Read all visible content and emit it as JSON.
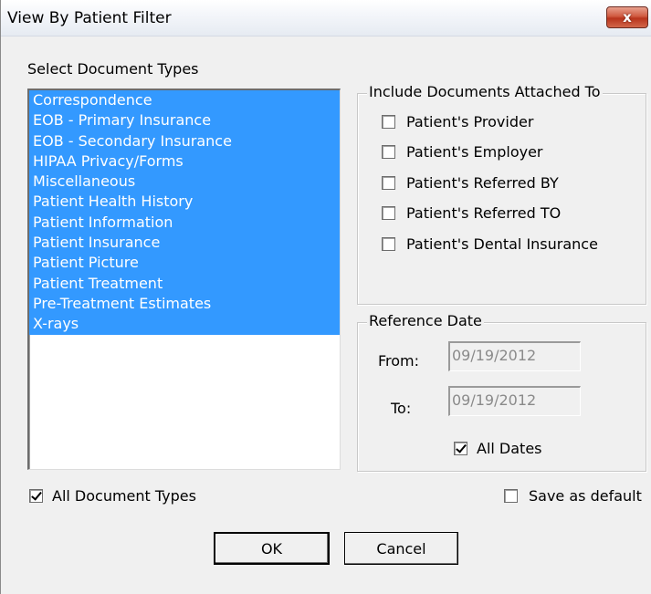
{
  "window": {
    "title": "View By Patient Filter",
    "close_glyph": "x"
  },
  "document_types": {
    "heading": "Select Document Types",
    "items": [
      "Correspondence",
      "EOB - Primary Insurance",
      "EOB - Secondary Insurance",
      "HIPAA Privacy/Forms",
      "Miscellaneous",
      "Patient Health History",
      "Patient Information",
      "Patient Insurance",
      "Patient Picture",
      "Patient Treatment",
      "Pre-Treatment Estimates",
      "X-rays"
    ],
    "all_types_label": "All Document Types",
    "all_types_checked": true
  },
  "attached_to": {
    "heading": "Include Documents Attached To",
    "options": [
      {
        "label": "Patient's Provider",
        "checked": false
      },
      {
        "label": "Patient's Employer",
        "checked": false
      },
      {
        "label": "Patient's Referred BY",
        "checked": false
      },
      {
        "label": "Patient's Referred TO",
        "checked": false
      },
      {
        "label": "Patient's Dental Insurance",
        "checked": false
      }
    ]
  },
  "reference_date": {
    "heading": "Reference Date",
    "from_label": "From:",
    "from_value": "09/19/2012",
    "to_label": "To:",
    "to_value": "09/19/2012",
    "all_dates_label": "All Dates",
    "all_dates_checked": true
  },
  "save_default": {
    "label": "Save as default",
    "checked": false
  },
  "buttons": {
    "ok": "OK",
    "cancel": "Cancel"
  },
  "colors": {
    "selection": "#3399ff",
    "dialog_bg": "#f0f0f0",
    "close_button": "#c7452c"
  }
}
